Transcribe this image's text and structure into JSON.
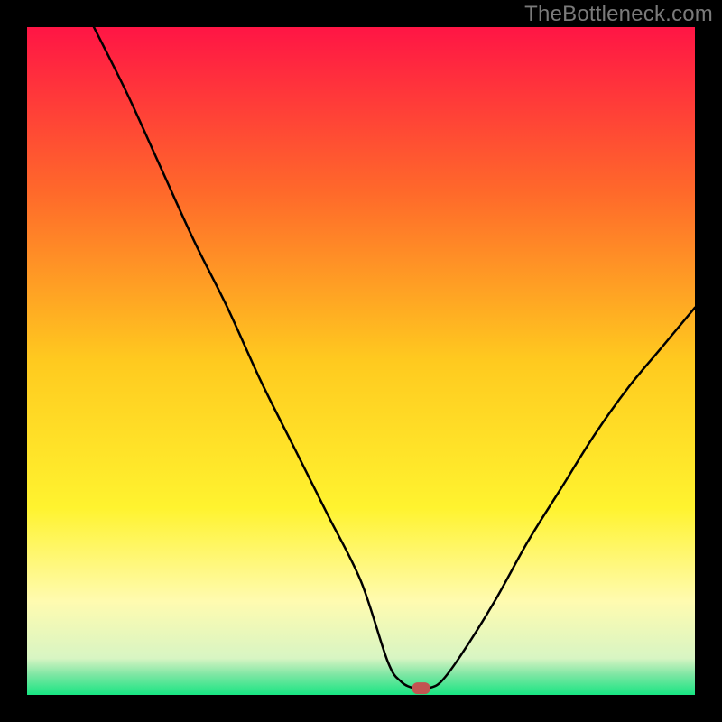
{
  "attribution": "TheBottleneck.com",
  "chart_data": {
    "type": "line",
    "title": "",
    "xlabel": "",
    "ylabel": "",
    "xlim": [
      0,
      100
    ],
    "ylim": [
      0,
      100
    ],
    "series": [
      {
        "name": "bottleneck-curve",
        "x": [
          10,
          15,
          20,
          25,
          30,
          35,
          40,
          45,
          50,
          54,
          56,
          58,
          60,
          62,
          65,
          70,
          75,
          80,
          85,
          90,
          95,
          100
        ],
        "values": [
          100,
          90,
          79,
          68,
          58,
          47,
          37,
          27,
          17,
          5,
          2,
          1,
          1,
          2,
          6,
          14,
          23,
          31,
          39,
          46,
          52,
          58
        ]
      }
    ],
    "marker": {
      "x": 59,
      "y": 1
    },
    "gradient_stops": [
      {
        "offset": 0,
        "color": "#ff1545"
      },
      {
        "offset": 0.25,
        "color": "#ff6a2a"
      },
      {
        "offset": 0.5,
        "color": "#ffca1f"
      },
      {
        "offset": 0.72,
        "color": "#fff32f"
      },
      {
        "offset": 0.86,
        "color": "#fffbb0"
      },
      {
        "offset": 0.945,
        "color": "#d8f5c3"
      },
      {
        "offset": 0.97,
        "color": "#7de6a3"
      },
      {
        "offset": 1.0,
        "color": "#17e582"
      }
    ]
  }
}
